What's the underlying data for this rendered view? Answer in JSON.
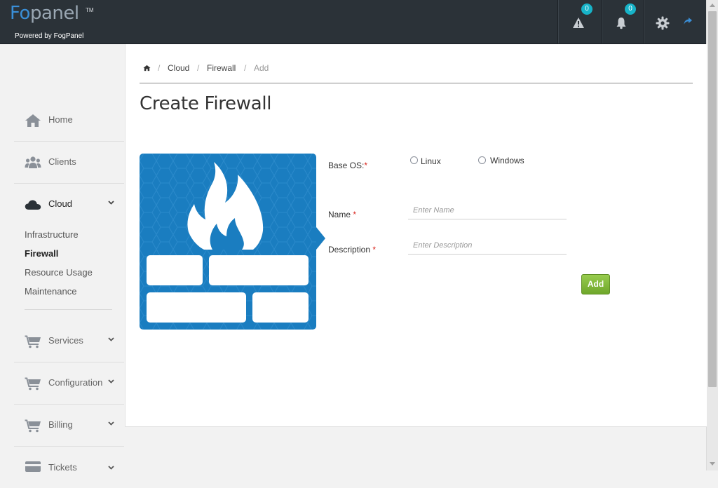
{
  "header": {
    "logo_fo": "Fo",
    "logo_panel": "panel",
    "logo_tm": "TM",
    "powered_by": "Powered by FogPanel",
    "alerts_count": "0",
    "notifications_count": "0",
    "icons": [
      "warning-icon",
      "bell-icon",
      "gear-icon",
      "share-icon"
    ]
  },
  "sidebar": {
    "items": [
      {
        "label": "Home",
        "icon": "home-icon"
      },
      {
        "label": "Clients",
        "icon": "users-icon"
      },
      {
        "label": "Cloud",
        "icon": "cloud-icon",
        "expanded": true
      },
      {
        "label": "Services",
        "icon": "cart-icon"
      },
      {
        "label": "Configuration",
        "icon": "cart-icon"
      },
      {
        "label": "Billing",
        "icon": "cart-icon"
      },
      {
        "label": "Tickets",
        "icon": "card-icon"
      }
    ],
    "cloud_subitems": [
      {
        "label": "Infrastructure"
      },
      {
        "label": "Firewall",
        "active": true
      },
      {
        "label": "Resource Usage"
      },
      {
        "label": "Maintenance"
      }
    ]
  },
  "breadcrumb": {
    "home_icon": "home-icon",
    "items": [
      "Cloud",
      "Firewall",
      "Add"
    ],
    "separator": "/"
  },
  "page": {
    "title": "Create Firewall"
  },
  "form": {
    "base_os_label": "Base OS:",
    "os_options": [
      "Linux",
      "Windows"
    ],
    "name_label": "Name",
    "name_placeholder": "Enter Name",
    "description_label": "Description",
    "description_placeholder": "Enter Description",
    "required_mark": "*",
    "add_button": "Add"
  },
  "colors": {
    "header_bg": "#2b3238",
    "badge": "#17b3c8",
    "accent_blue": "#1a7dc0",
    "add_button_green": "#7cb534",
    "required_red": "#d9231b"
  }
}
